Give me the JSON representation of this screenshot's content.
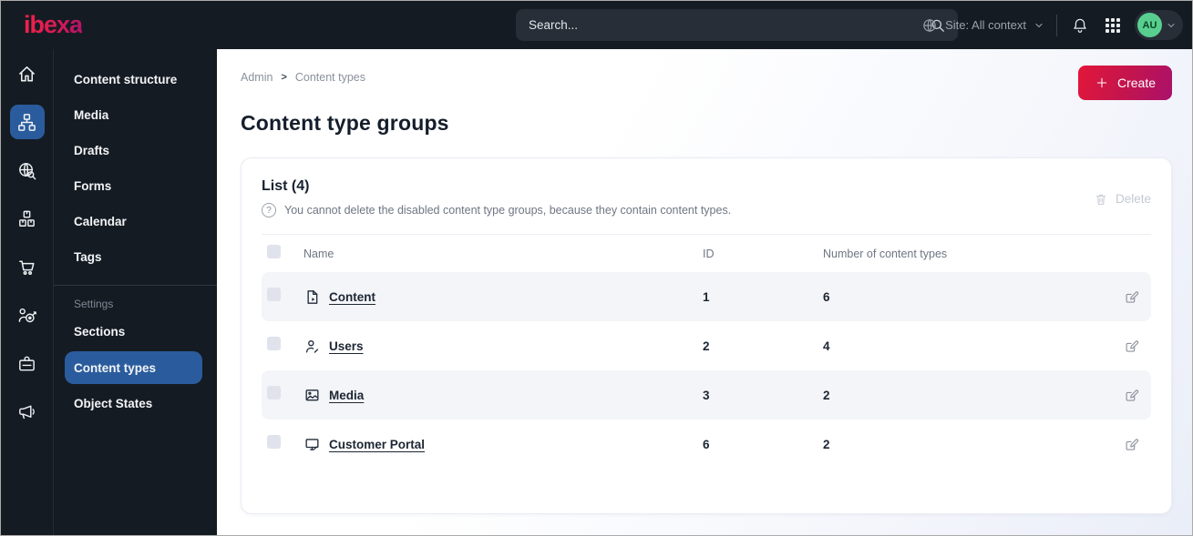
{
  "topbar": {
    "logo_text": "ibexa",
    "search": {
      "placeholder": "Search..."
    },
    "site_context_label": "Site: All context",
    "avatar_initials": "AU"
  },
  "nav_rail": {
    "items": [
      {
        "name": "home",
        "icon": "home-icon",
        "active": false
      },
      {
        "name": "content",
        "icon": "sitemap-icon",
        "active": true
      },
      {
        "name": "search",
        "icon": "globe-search-icon",
        "active": false
      },
      {
        "name": "product-catalog",
        "icon": "boxes-icon",
        "active": false
      },
      {
        "name": "commerce",
        "icon": "cart-icon",
        "active": false
      },
      {
        "name": "personalization",
        "icon": "target-user-icon",
        "active": false
      },
      {
        "name": "admin",
        "icon": "id-badge-icon",
        "active": false
      },
      {
        "name": "marketing",
        "icon": "megaphone-icon",
        "active": false
      }
    ]
  },
  "sidebar": {
    "primary_items": [
      "Content structure",
      "Media",
      "Drafts",
      "Forms",
      "Calendar",
      "Tags"
    ],
    "section_label": "Settings",
    "settings_items": [
      "Sections",
      "Content types",
      "Object States"
    ],
    "active_item": "Content types"
  },
  "main": {
    "breadcrumb": {
      "root": "Admin",
      "separator": ">",
      "current": "Content types"
    },
    "create_button_label": "Create",
    "page_title": "Content type groups",
    "list_card": {
      "title": "List (4)",
      "hint_icon": "?",
      "hint": "You cannot delete the disabled content type groups, because they contain content types.",
      "delete_button_label": "Delete",
      "columns": {
        "name": "Name",
        "id": "ID",
        "count": "Number of content types"
      },
      "rows": [
        {
          "icon": "file-icon",
          "name": "Content",
          "id": "1",
          "count": "6"
        },
        {
          "icon": "user-icon",
          "name": "Users",
          "id": "2",
          "count": "4"
        },
        {
          "icon": "image-icon",
          "name": "Media",
          "id": "3",
          "count": "2"
        },
        {
          "icon": "monitor-icon",
          "name": "Customer Portal",
          "id": "6",
          "count": "2"
        }
      ]
    }
  },
  "colors": {
    "topbar_bg": "#151b23",
    "active_blue": "#2a5c9d",
    "brand_gradient_start": "#e31739",
    "brand_gradient_end": "#aa116b",
    "avatar_green": "#58cf8e",
    "shaded_row": "#f4f5f8"
  }
}
